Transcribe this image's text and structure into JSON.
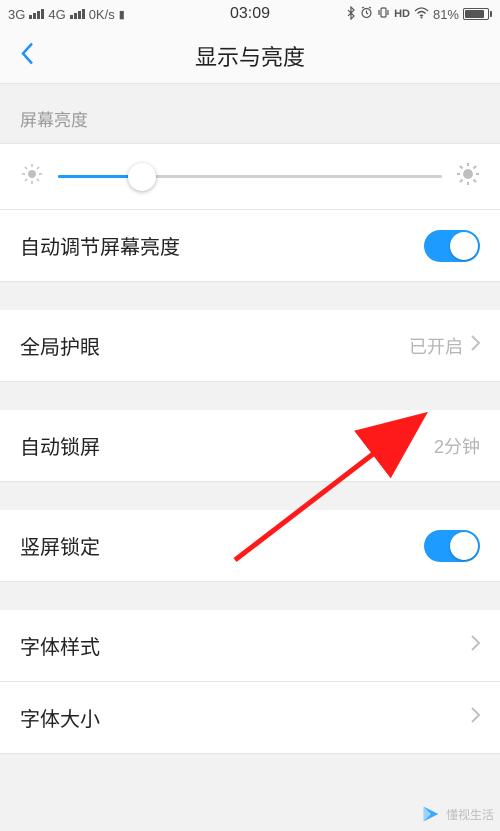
{
  "status": {
    "net1": "3G",
    "net2": "4G",
    "speed": "0K/s",
    "time": "03:09",
    "hd": "HD",
    "battery_pct": "81%",
    "battery_fill_pct": 81
  },
  "header": {
    "title": "显示与亮度"
  },
  "brightness": {
    "section_label": "屏幕亮度",
    "slider_pct": 22,
    "auto_label": "自动调节屏幕亮度",
    "auto_on": true
  },
  "eye_care": {
    "label": "全局护眼",
    "value": "已开启"
  },
  "auto_lock": {
    "label": "自动锁屏",
    "value": "2分钟"
  },
  "portrait_lock": {
    "label": "竖屏锁定",
    "on": true
  },
  "font_style": {
    "label": "字体样式"
  },
  "font_size": {
    "label": "字体大小"
  },
  "watermark": "懂视生活"
}
